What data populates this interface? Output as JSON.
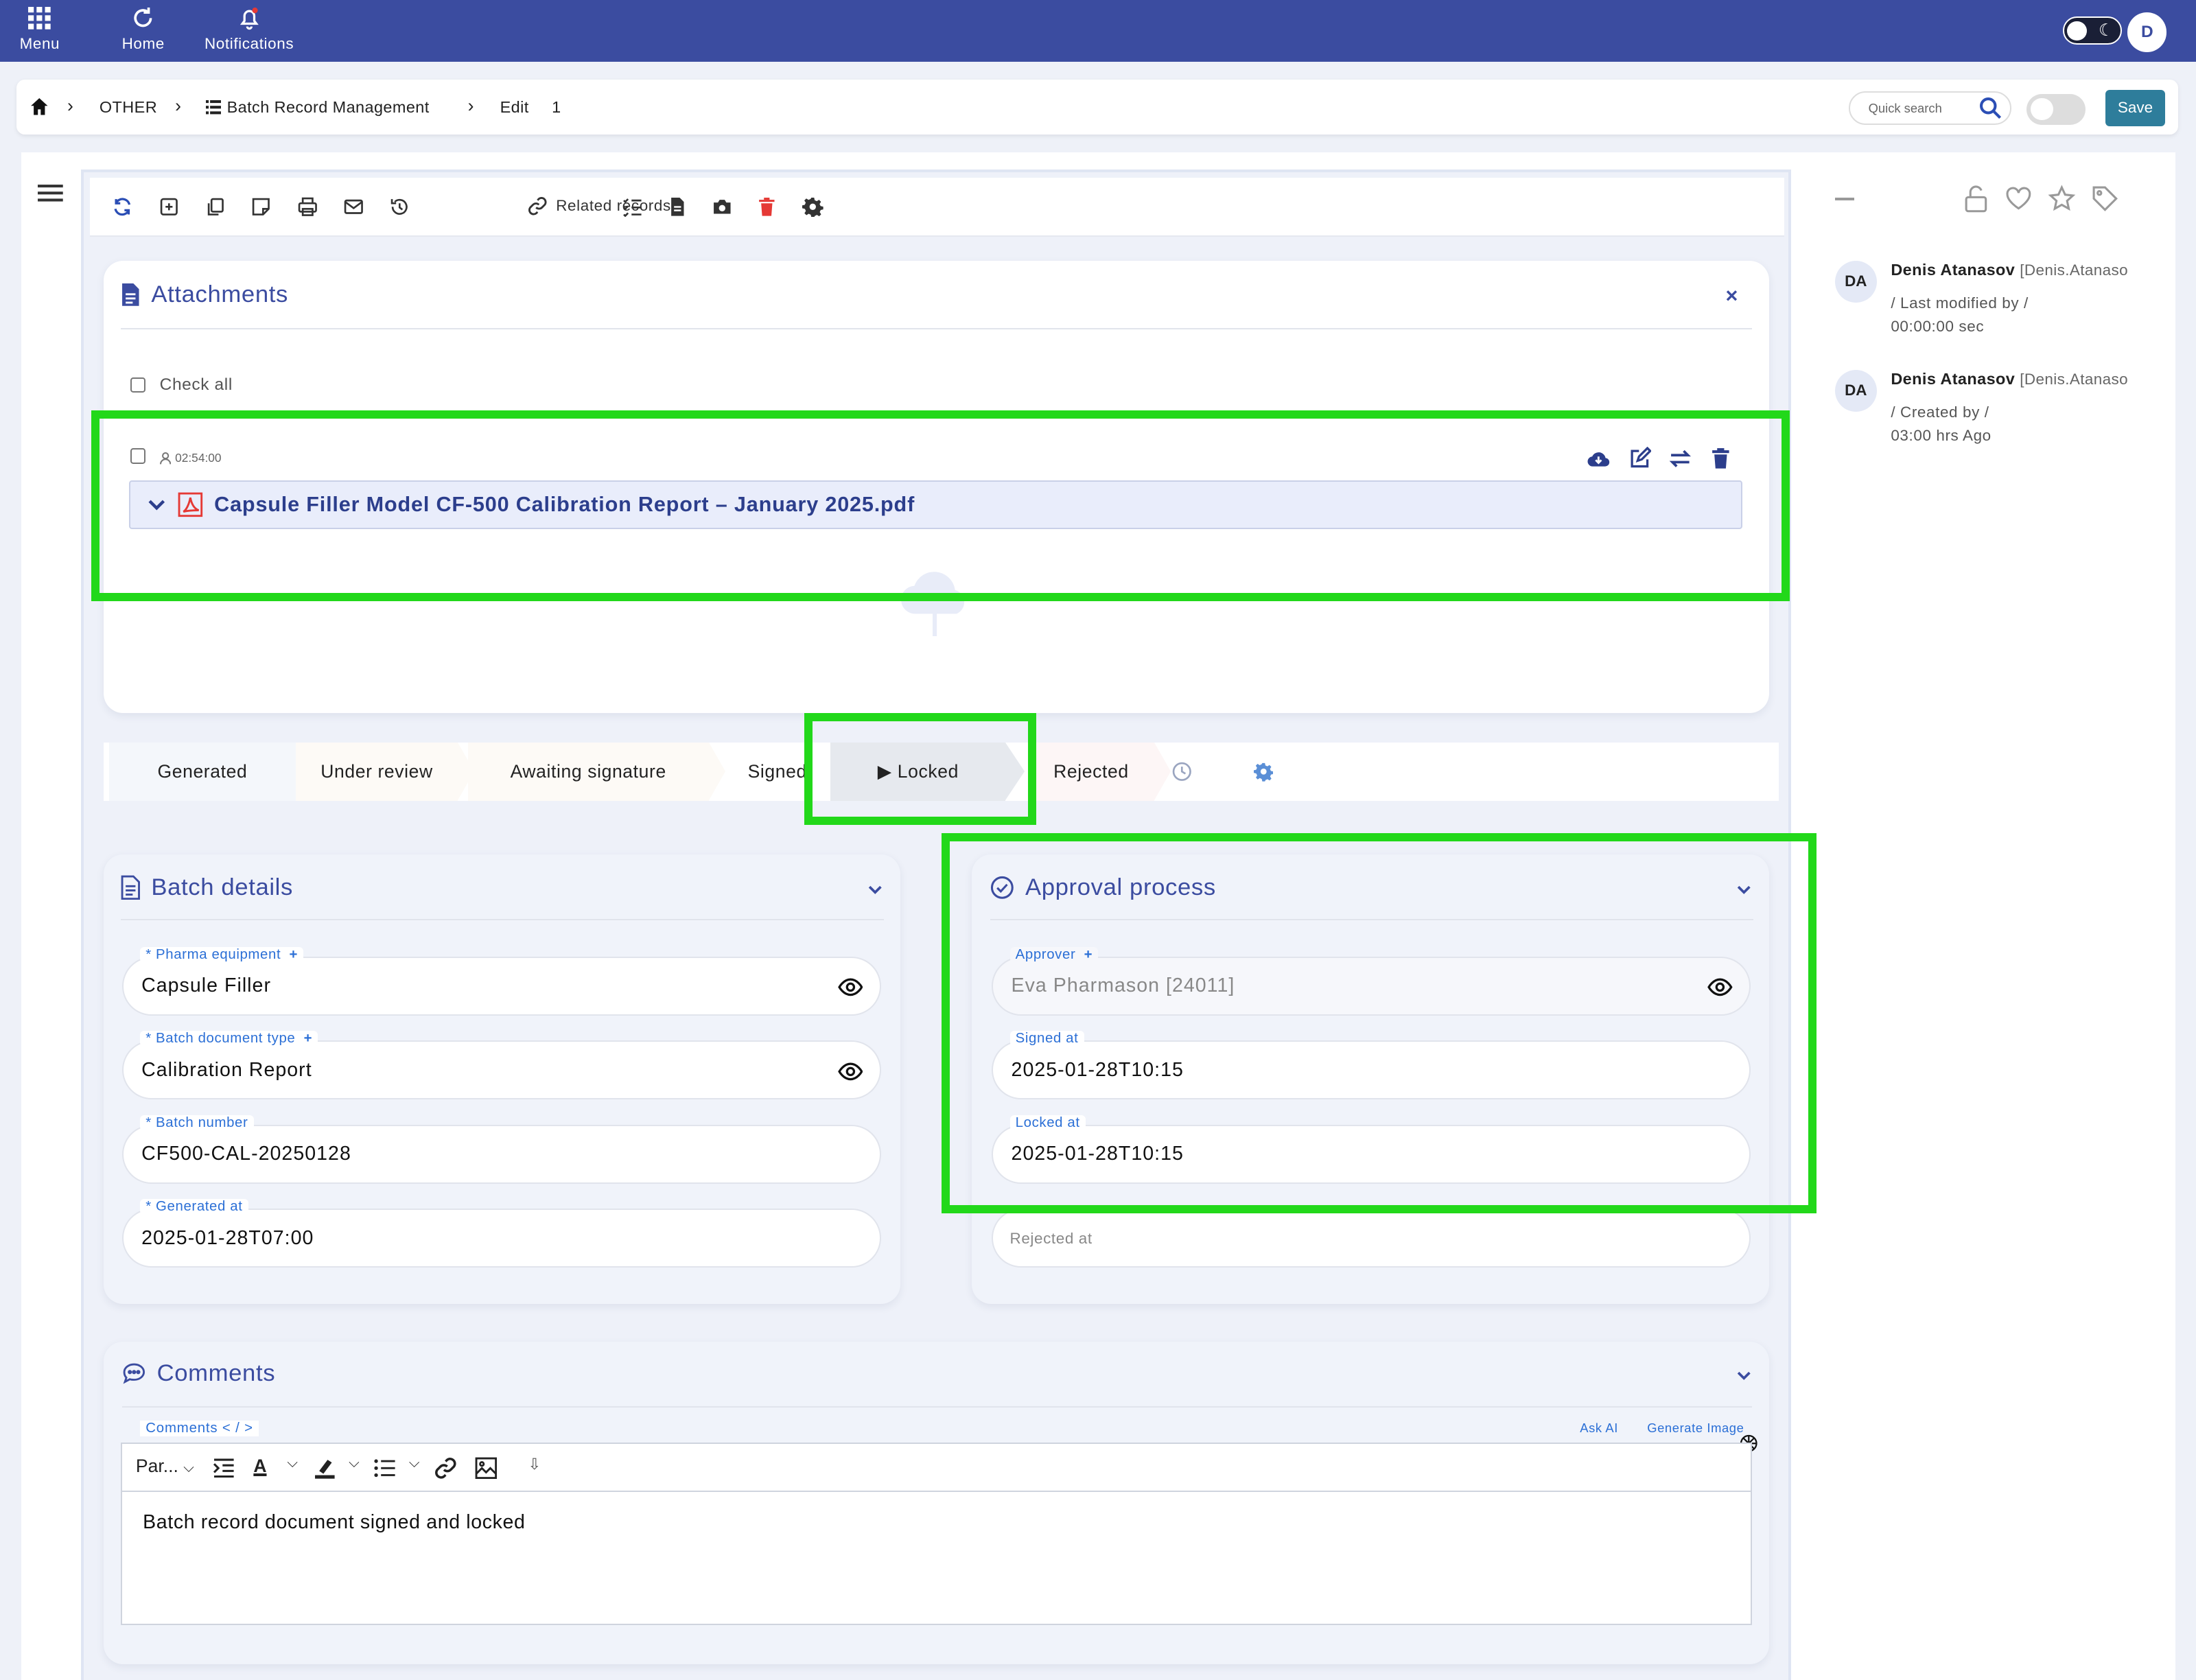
{
  "topbar": {
    "menu_label": "Menu",
    "home_label": "Home",
    "notifications_label": "Notifications",
    "user_initial": "D"
  },
  "breadcrumb": {
    "items": [
      "OTHER",
      "Batch Record Management",
      "Edit",
      "1"
    ],
    "search_placeholder": "Quick search",
    "save_label": "Save"
  },
  "toolbar": {
    "related_label": "Related records"
  },
  "attachments": {
    "title": "Attachments",
    "check_all": "Check all",
    "time": "02:54:00",
    "file_name": "Capsule Filler Model CF-500 Calibration Report – January 2025.pdf"
  },
  "workflow": {
    "steps": [
      "Generated",
      "Under review",
      "Awaiting signature",
      "Signed",
      "▶ Locked",
      "Rejected"
    ],
    "active": "Locked"
  },
  "batch_details": {
    "title": "Batch details",
    "fields": [
      {
        "label": "* Pharma equipment",
        "value": "Capsule Filler"
      },
      {
        "label": "* Batch document type",
        "value": "Calibration Report"
      },
      {
        "label": "* Batch number",
        "value": "CF500-CAL-20250128"
      },
      {
        "label": "* Generated at",
        "value": "2025-01-28T07:00"
      }
    ]
  },
  "approval": {
    "title": "Approval process",
    "fields": [
      {
        "label": "Approver",
        "value": "Eva Pharmason [24011]"
      },
      {
        "label": "Signed at",
        "value": "2025-01-28T10:15"
      },
      {
        "label": "Locked at",
        "value": "2025-01-28T10:15"
      },
      {
        "label": "Rejected at",
        "value": ""
      }
    ]
  },
  "comments": {
    "title": "Comments",
    "label": "Comments < / >",
    "ask_ai": "Ask AI",
    "generate_image": "Generate Image",
    "paragraph": "Par...",
    "body": "Batch record document signed and locked"
  },
  "activity": [
    {
      "initials": "DA",
      "name": "Denis Atanasov",
      "username": "[Denis.Atanaso",
      "action": "/ Last modified by /",
      "time": "00:00:00 sec"
    },
    {
      "initials": "DA",
      "name": "Denis Atanasov",
      "username": "[Denis.Atanaso",
      "action": "/ Created by /",
      "time": "03:00 hrs Ago"
    }
  ],
  "colors": {
    "topbar": "#3b4ca0",
    "accent": "#2c3e8c",
    "save": "#2e7d9b",
    "highlight": "#22d81a",
    "delete": "#e53935"
  }
}
